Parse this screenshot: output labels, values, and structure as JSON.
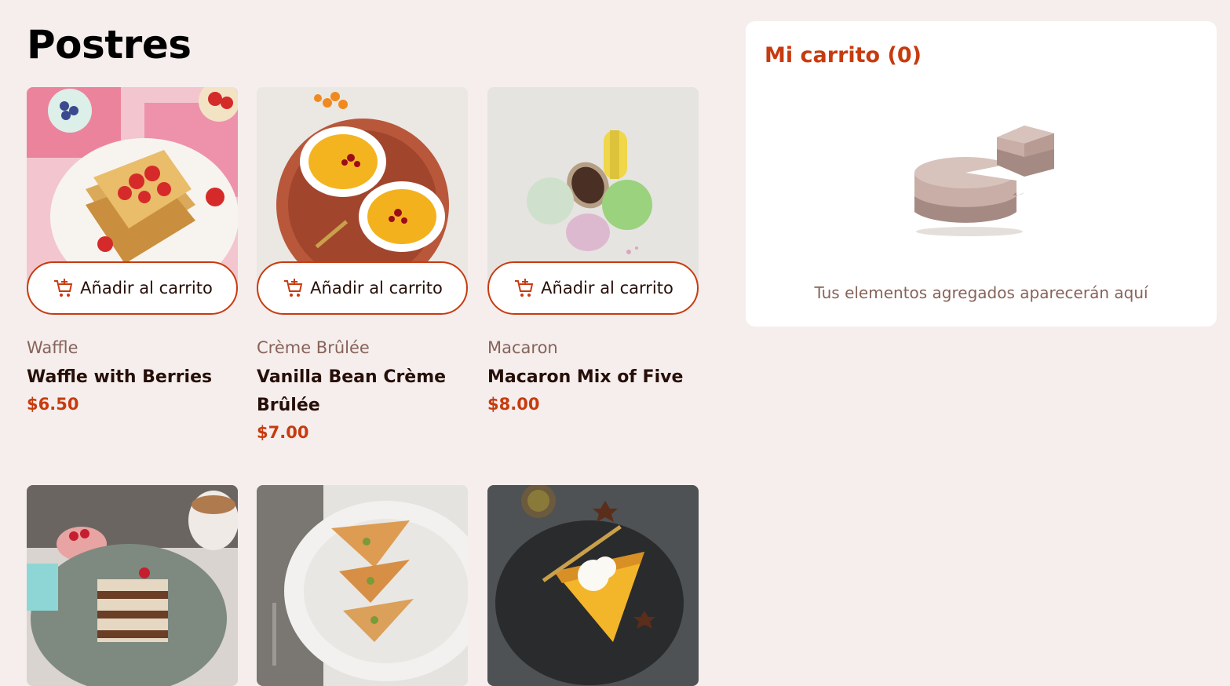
{
  "page": {
    "title": "Postres"
  },
  "products": [
    {
      "category": "Waffle",
      "name": "Waffle with Berries",
      "price": "$6.50",
      "button": "Añadir al carrito",
      "image_icon": "waffle-image"
    },
    {
      "category": "Crème Brûlée",
      "name": "Vanilla Bean Crème Brûlée",
      "price": "$7.00",
      "button": "Añadir al carrito",
      "image_icon": "creme-brulee-image"
    },
    {
      "category": "Macaron",
      "name": "Macaron Mix of Five",
      "price": "$8.00",
      "button": "Añadir al carrito",
      "image_icon": "macaron-image"
    },
    {
      "image_icon": "tiramisu-image"
    },
    {
      "image_icon": "baklava-image"
    },
    {
      "image_icon": "pie-image"
    }
  ],
  "cart": {
    "title": "Mi carrito (0)",
    "empty_message": "Tus elementos agregados aparecerán aquí",
    "illustration_icon": "empty-cake-icon"
  },
  "colors": {
    "accent": "#c73b0f",
    "background": "#f5eeec",
    "text": "#260f08",
    "muted": "#87635a"
  }
}
